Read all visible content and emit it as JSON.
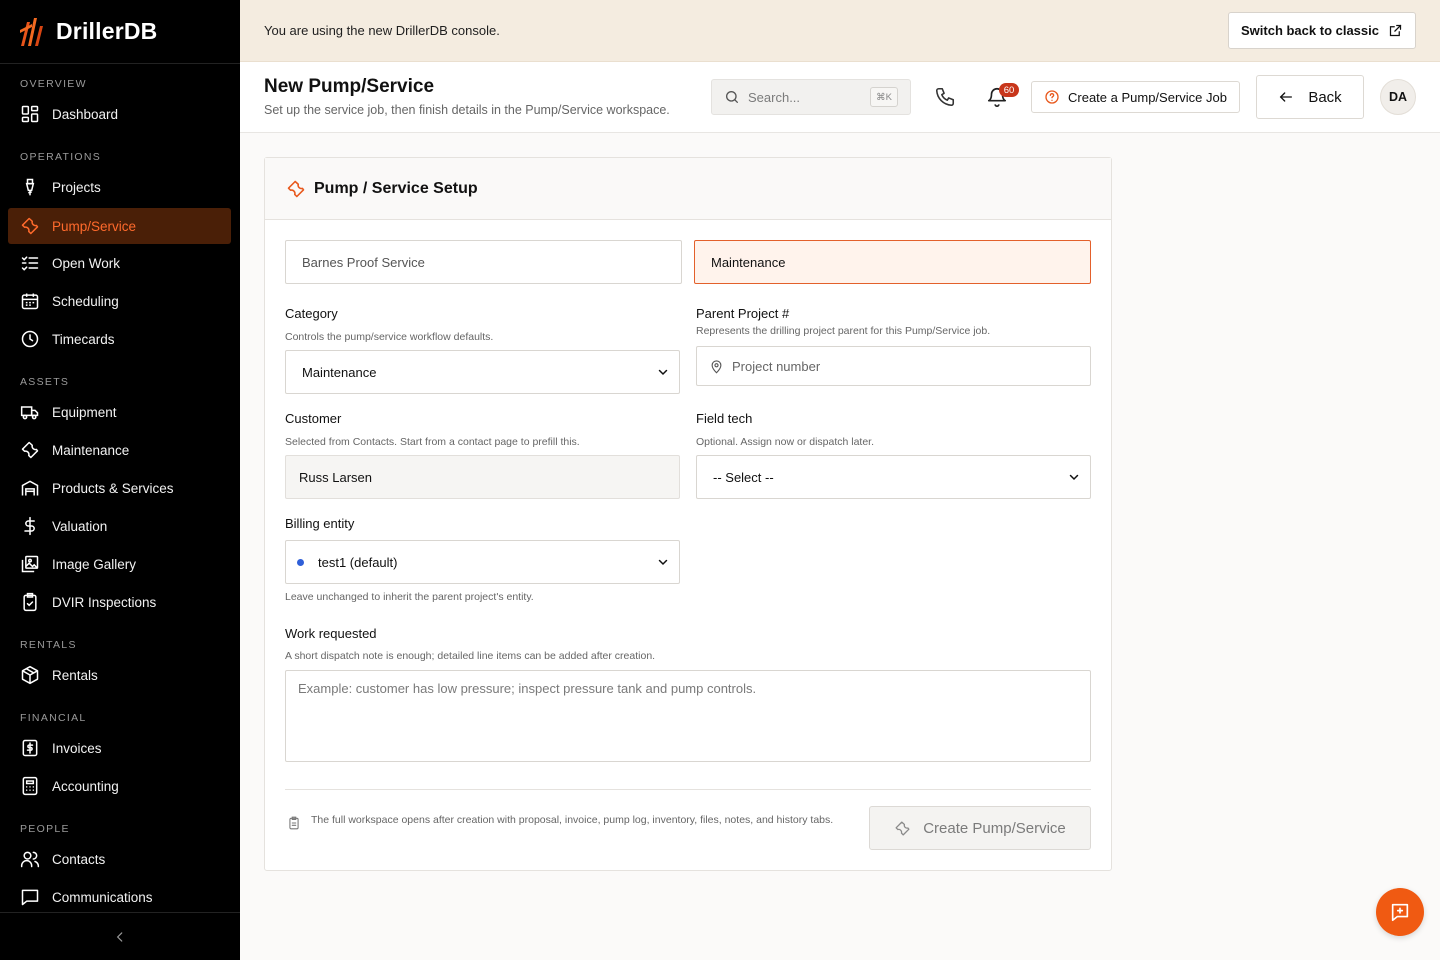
{
  "app": {
    "name": "DrillerDB"
  },
  "colors": {
    "accent": "#f05a12",
    "active_bg": "#4a1f07",
    "active_text": "#ff6a2c",
    "banner_bg": "#f4ece0",
    "badge": "#c8361b",
    "entity_dot": "#2f5fd8"
  },
  "sidebar": {
    "sections": [
      {
        "label": "OVERVIEW",
        "items": [
          {
            "label": "Dashboard",
            "icon": "dashboard-icon"
          }
        ]
      },
      {
        "label": "OPERATIONS",
        "items": [
          {
            "label": "Projects",
            "icon": "drill-icon"
          },
          {
            "label": "Pump/Service",
            "icon": "wrench-icon",
            "active": true
          },
          {
            "label": "Open Work",
            "icon": "checklist-icon"
          },
          {
            "label": "Scheduling",
            "icon": "calendar-icon"
          },
          {
            "label": "Timecards",
            "icon": "clock-icon"
          }
        ]
      },
      {
        "label": "ASSETS",
        "items": [
          {
            "label": "Equipment",
            "icon": "truck-icon"
          },
          {
            "label": "Maintenance",
            "icon": "wrench-icon"
          },
          {
            "label": "Products & Services",
            "icon": "warehouse-icon"
          },
          {
            "label": "Valuation",
            "icon": "dollar-icon"
          },
          {
            "label": "Image Gallery",
            "icon": "gallery-icon"
          },
          {
            "label": "DVIR Inspections",
            "icon": "clipboard-check-icon"
          }
        ]
      },
      {
        "label": "RENTALS",
        "items": [
          {
            "label": "Rentals",
            "icon": "package-icon"
          }
        ]
      },
      {
        "label": "FINANCIAL",
        "items": [
          {
            "label": "Invoices",
            "icon": "invoice-icon"
          },
          {
            "label": "Accounting",
            "icon": "calculator-icon"
          }
        ]
      },
      {
        "label": "PEOPLE",
        "items": [
          {
            "label": "Contacts",
            "icon": "users-icon"
          },
          {
            "label": "Communications",
            "icon": "message-icon"
          }
        ]
      }
    ]
  },
  "banner": {
    "text": "You are using the new DrillerDB console.",
    "button": "Switch back to classic"
  },
  "header": {
    "title": "New Pump/Service",
    "subtitle": "Set up the service job, then finish details in the Pump/Service workspace.",
    "search_placeholder": "Search...",
    "search_shortcut": "⌘K",
    "notification_count": "60",
    "create_job": "Create a Pump/Service Job",
    "back": "Back",
    "avatar": "DA"
  },
  "card": {
    "title": "Pump / Service Setup",
    "name_placeholder": "Barnes Proof Service",
    "type_value": "Maintenance",
    "category": {
      "label": "Category",
      "hint": "Controls the pump/service workflow defaults.",
      "value": "Maintenance"
    },
    "parent_project": {
      "label": "Parent Project #",
      "hint": "Represents the drilling project parent for this Pump/Service job.",
      "placeholder": "Project number"
    },
    "customer": {
      "label": "Customer",
      "hint": "Selected from Contacts. Start from a contact page to prefill this.",
      "value": "Russ Larsen"
    },
    "field_tech": {
      "label": "Field tech",
      "hint": "Optional. Assign now or dispatch later.",
      "value": "-- Select --"
    },
    "billing_entity": {
      "label": "Billing entity",
      "value": "test1 (default)",
      "hint": "Leave unchanged to inherit the parent project's entity."
    },
    "work_requested": {
      "label": "Work requested",
      "hint": "A short dispatch note is enough; detailed line items can be added after creation.",
      "placeholder": "Example: customer has low pressure; inspect pressure tank and pump controls."
    },
    "footnote": "The full workspace opens after creation with proposal, invoice, pump log, inventory, files, notes, and history tabs.",
    "submit": "Create Pump/Service"
  }
}
